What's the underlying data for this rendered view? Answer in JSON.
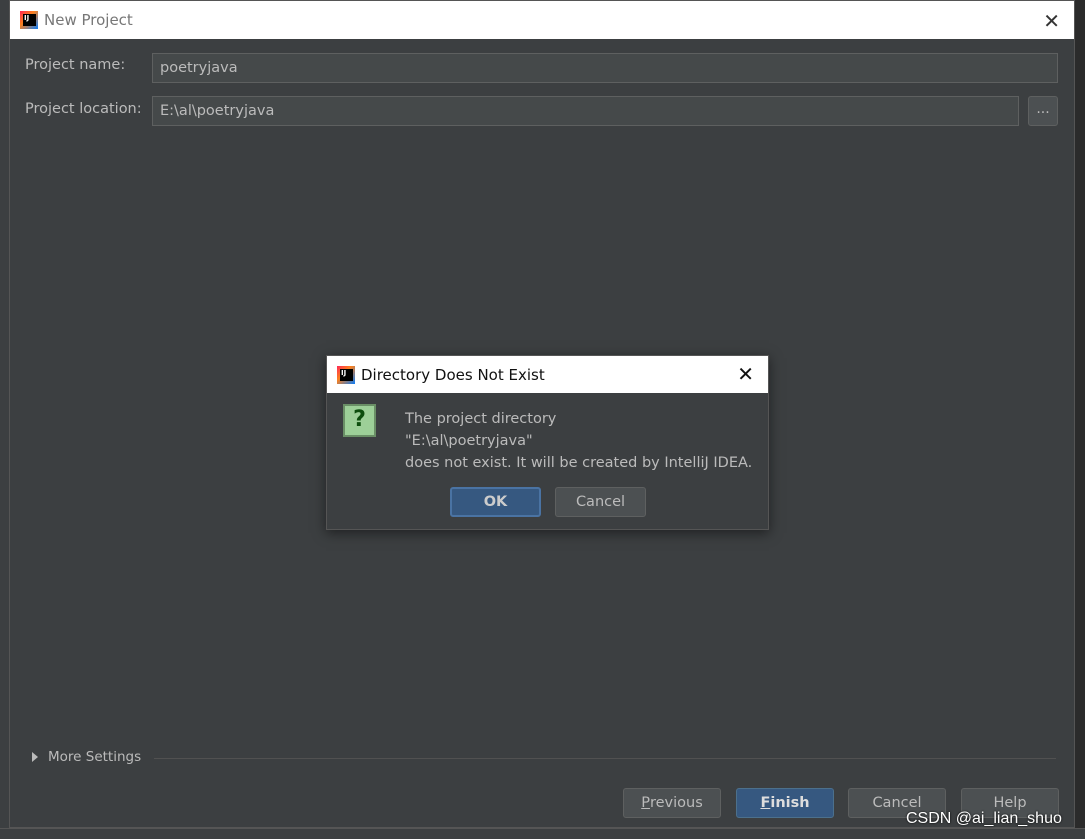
{
  "window": {
    "title": "New Project"
  },
  "form": {
    "project_name_label": "Project name:",
    "project_name_value": "poetryjava",
    "project_location_label": "Project location:",
    "project_location_value": "E:\\al\\poetryjava",
    "browse_label": "..."
  },
  "more_settings": "More Settings",
  "footer": {
    "previous_mnemonic": "P",
    "previous_rest": "revious",
    "finish_mnemonic": "F",
    "finish_rest": "inish",
    "cancel": "Cancel",
    "help": "Help"
  },
  "dialog": {
    "title": "Directory Does Not Exist",
    "line1": "The project directory",
    "line2": "\"E:\\al\\poetryjava\"",
    "line3": "does not exist. It will be created by IntelliJ IDEA.",
    "ok": "OK",
    "cancel": "Cancel",
    "icon": "question-icon"
  },
  "watermark": "CSDN @ai_lian_shuo",
  "colors": {
    "accent": "#365880",
    "background": "#3c3f41",
    "input": "#45494a"
  }
}
